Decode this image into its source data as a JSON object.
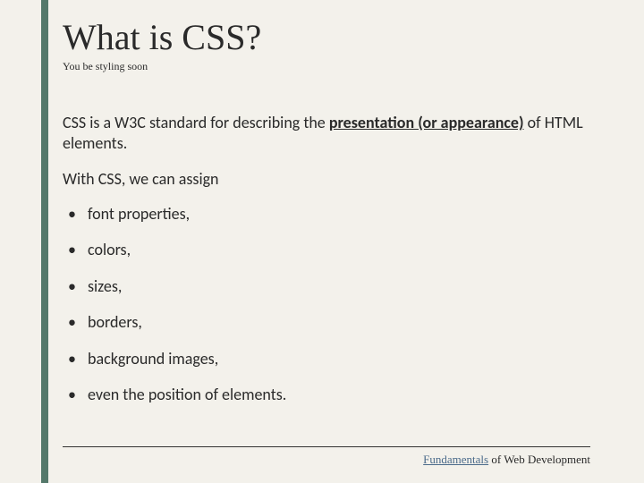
{
  "slide": {
    "title": "What is CSS?",
    "subtitle": "You be styling soon",
    "para1_pre": "CSS is a W3C standard for describing the ",
    "para1_bold": "presentation (or appearance)",
    "para1_post": " of HTML elements.",
    "para2": "With CSS, we can assign",
    "bullets": {
      "0": "font properties,",
      "1": "colors,",
      "2": "sizes,",
      "3": "borders,",
      "4": "background images,",
      "5": "even the position of elements."
    },
    "footer": {
      "part1": "Fundamentals",
      "part2": " of Web Development"
    }
  }
}
